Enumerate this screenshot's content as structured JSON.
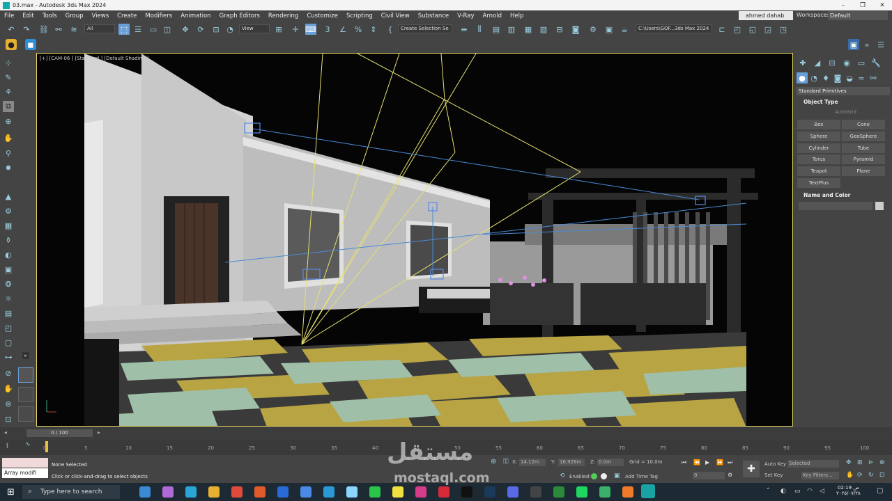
{
  "window": {
    "title": "03.max - Autodesk 3ds Max 2024",
    "controls": [
      "–",
      "❐",
      "✕"
    ]
  },
  "menu": {
    "items": [
      "File",
      "Edit",
      "Tools",
      "Group",
      "Views",
      "Create",
      "Modifiers",
      "Animation",
      "Graph Editors",
      "Rendering",
      "Customize",
      "Scripting",
      "Civil View",
      "Substance",
      "V-Ray",
      "Arnold",
      "Help"
    ],
    "user": "ahmed dahab",
    "workspaces_label": "Workspaces:",
    "workspace": "Default"
  },
  "toolbar": {
    "selection_filter": "All",
    "ref_coord": "View",
    "named_selection": "Create Selection Se",
    "project_path": "C:\\Users\\GOF...3ds Max 2024"
  },
  "viewport": {
    "label": "[+] [CAM-06 ] [Standard ] [Default Shading ]"
  },
  "command_panel": {
    "category": "Standard Primitives",
    "object_type_title": "Object Type",
    "autogrid": "AutoGrid",
    "buttons": [
      "Box",
      "Cone",
      "Sphere",
      "GeoSphere",
      "Cylinder",
      "Tube",
      "Torus",
      "Pyramid",
      "Teapot",
      "Plane",
      "TextPlus"
    ],
    "name_color_title": "Name and Color"
  },
  "timeline": {
    "frame": "0 / 100",
    "ticks": [
      "0",
      "5",
      "10",
      "15",
      "20",
      "25",
      "30",
      "35",
      "40",
      "45",
      "50",
      "55",
      "60",
      "65",
      "70",
      "75",
      "80",
      "85",
      "90",
      "95",
      "100"
    ]
  },
  "status": {
    "maxscript_value": "Array modifi",
    "selection": "None Selected",
    "prompt": "Click or click-and-drag to select objects",
    "x_label": "X:",
    "x": "14.12m",
    "y_label": "Y:",
    "y": "16.928m",
    "z_label": "Z:",
    "z": "0.0m",
    "grid": "Grid = 10.0m",
    "enabled_label": "Enabled:",
    "add_time_tag": "Add Time Tag",
    "auto_key": "Auto Key",
    "set_key": "Set Key",
    "selected": "Selected",
    "key_filters": "Key Filters...",
    "frame_val": "0"
  },
  "taskbar": {
    "search": "Type here to search",
    "time": "02:19 ص",
    "date": "٢٠٢٥/٠٧/٢٨"
  },
  "watermark": {
    "arabic": "مستقل",
    "latin": "mostaql.com"
  }
}
